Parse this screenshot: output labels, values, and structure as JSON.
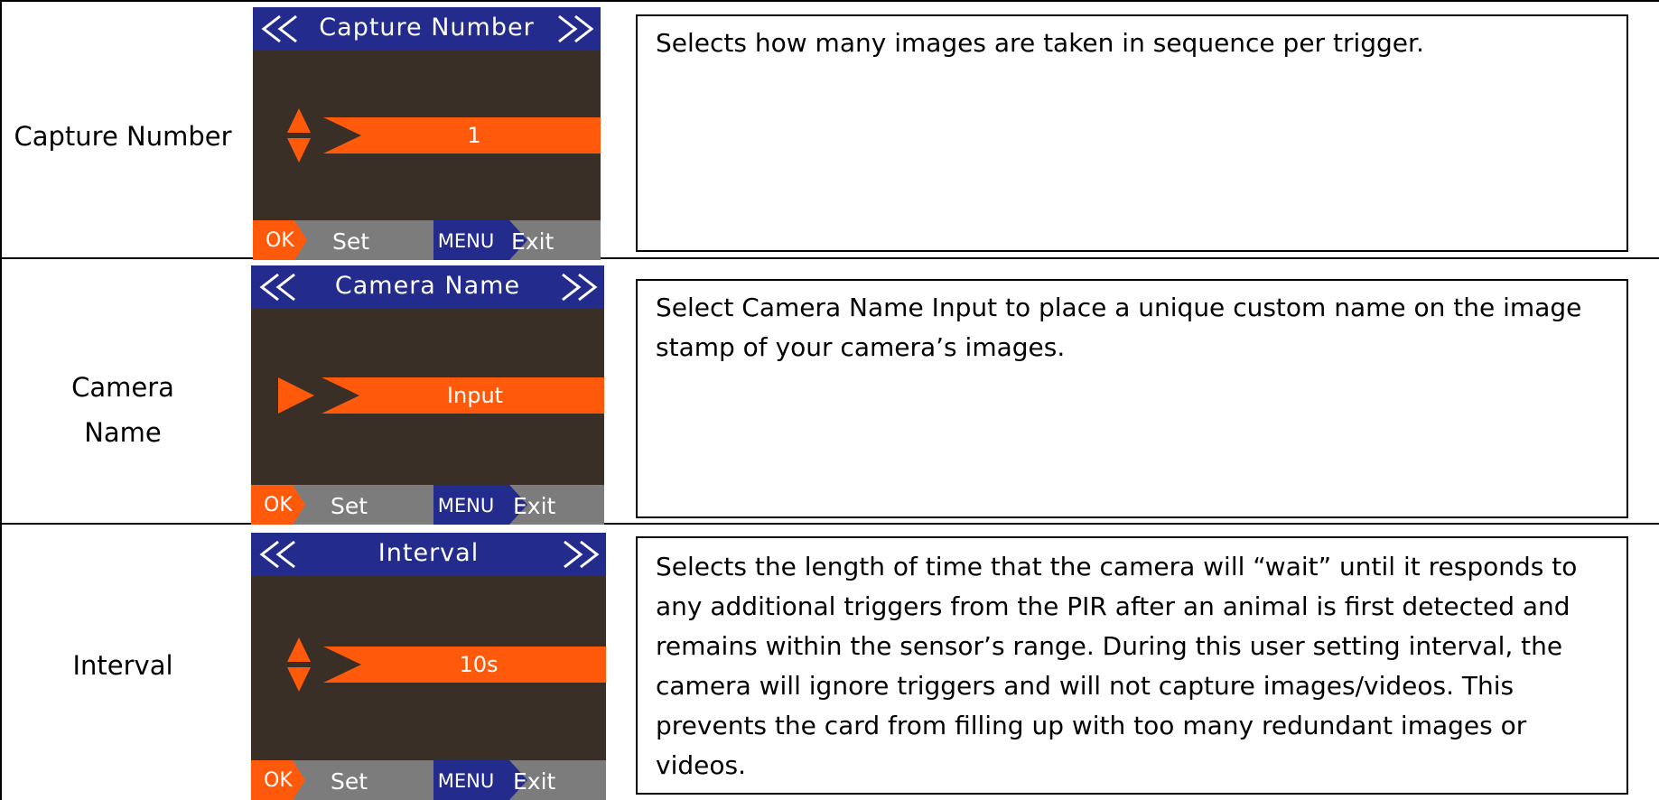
{
  "rows": [
    {
      "label": "Capture Number",
      "screen": {
        "title": "Capture Number",
        "value": "1",
        "ok_label": "OK",
        "set_label": "Set",
        "menu_label": "MENU",
        "exit_label": "Exit"
      },
      "description": "Selects how many images are taken in sequence per trigger."
    },
    {
      "label": "Camera\nName",
      "screen": {
        "title": "Camera Name",
        "value": "Input",
        "ok_label": "OK",
        "set_label": "Set",
        "menu_label": "MENU",
        "exit_label": "Exit"
      },
      "description": "Select Camera Name Input to place a unique custom name on the image stamp of your camera’s images."
    },
    {
      "label": "Interval",
      "screen": {
        "title": "Interval",
        "value": "10s",
        "ok_label": "OK",
        "set_label": "Set",
        "menu_label": "MENU",
        "exit_label": "Exit"
      },
      "description": "Selects the length of time that the camera will “wait” until it responds to any additional triggers from the PIR after an animal is first detected and remains within the sensor’s range.  During this user setting interval, the camera will ignore triggers and will not capture images/videos.  This prevents the card from filling up with too many redundant images or videos."
    }
  ],
  "colors": {
    "header_blue": "#232c8c",
    "screen_bg": "#3a2f26",
    "accent_orange": "#ff5a0c",
    "footer_gray": "#7c7c7c"
  }
}
